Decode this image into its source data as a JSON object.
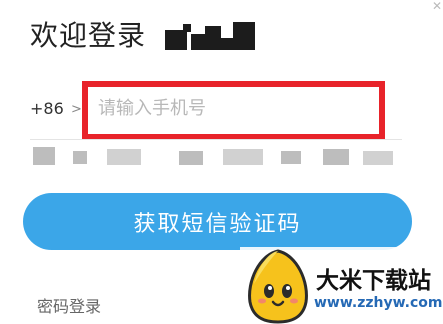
{
  "header": {
    "title": "欢迎登录"
  },
  "phone": {
    "country_code": "+86",
    "arrow_glyph": ">",
    "placeholder": "请输入手机号",
    "highlight_color": "#e8232a"
  },
  "actions": {
    "sms_button_label": "获取短信验证码",
    "password_login_label": "密码登录"
  },
  "colors": {
    "button": "#3ba6e8",
    "accent_red": "#e8232a"
  },
  "watermark": {
    "name": "大米下载站",
    "url": "www.zzhyw.com"
  },
  "icons": {
    "close": "close-icon",
    "arrow": "chevron-right-icon",
    "logo": "egg-mascot-logo"
  }
}
